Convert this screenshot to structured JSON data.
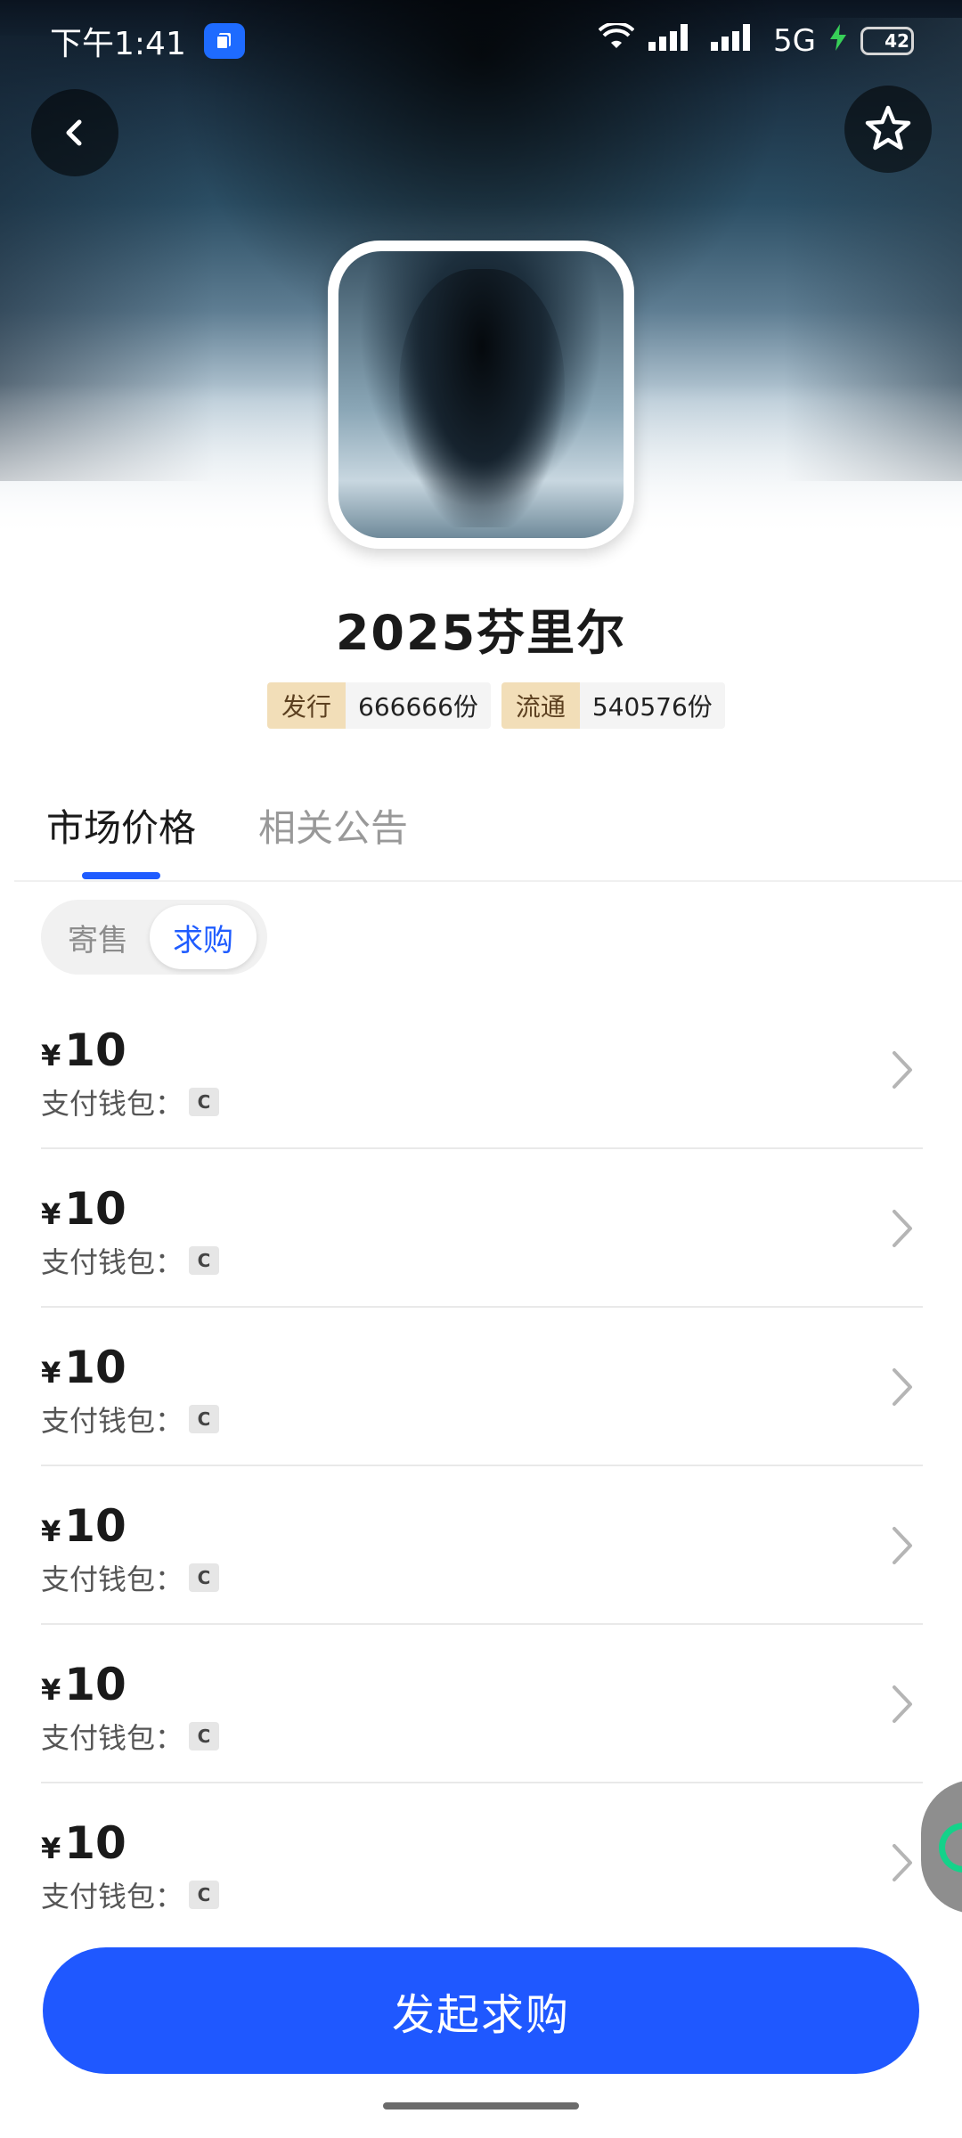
{
  "status_bar": {
    "time": "下午1:41",
    "network": "5G",
    "battery": "42"
  },
  "header": {
    "back_icon": "chevron-left-icon",
    "favorite_icon": "star-outline-icon"
  },
  "product": {
    "title": "2025芬里尔",
    "issue_label": "发行",
    "issue_value": "666666份",
    "circulation_label": "流通",
    "circulation_value": "540576份"
  },
  "tabs": [
    {
      "label": "市场价格",
      "active": true
    },
    {
      "label": "相关公告",
      "active": false
    }
  ],
  "segment": [
    {
      "label": "寄售",
      "active": false
    },
    {
      "label": "求购",
      "active": true
    }
  ],
  "listings": [
    {
      "currency": "¥",
      "price": "10",
      "wallet_label": "支付钱包：",
      "wallet_badge": "C"
    },
    {
      "currency": "¥",
      "price": "10",
      "wallet_label": "支付钱包：",
      "wallet_badge": "C"
    },
    {
      "currency": "¥",
      "price": "10",
      "wallet_label": "支付钱包：",
      "wallet_badge": "C"
    },
    {
      "currency": "¥",
      "price": "10",
      "wallet_label": "支付钱包：",
      "wallet_badge": "C"
    },
    {
      "currency": "¥",
      "price": "10",
      "wallet_label": "支付钱包：",
      "wallet_badge": "C"
    },
    {
      "currency": "¥",
      "price": "10",
      "wallet_label": "支付钱包：",
      "wallet_badge": "C"
    }
  ],
  "action": {
    "primary_label": "发起求购"
  },
  "colors": {
    "accent": "#1f58ff",
    "tag_bg": "#f2deb8",
    "float_chip_mark": "#14d28a"
  }
}
